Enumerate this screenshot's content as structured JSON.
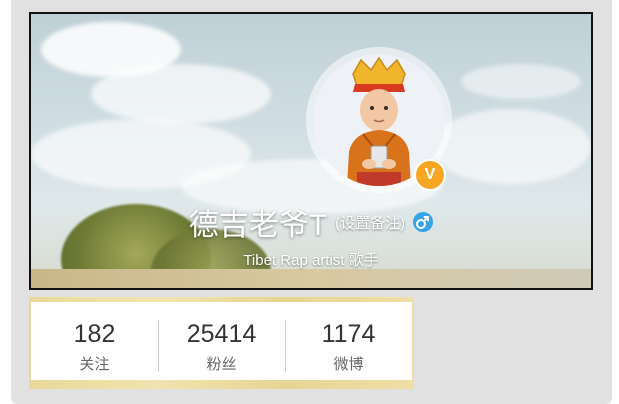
{
  "profile": {
    "nickname": "德吉老爷T",
    "remark_link": "(设置备注)",
    "bio": "Tibet Rap artist 歌手",
    "verified_mark": "V",
    "gender": "male",
    "gender_symbol": "♂"
  },
  "stats": [
    {
      "count": "182",
      "label": "关注"
    },
    {
      "count": "25414",
      "label": "粉丝"
    },
    {
      "count": "1174",
      "label": "微博"
    }
  ],
  "colors": {
    "verified_badge": "#f5a623",
    "gender_badge": "#38a4e8",
    "stats_border": "#e8d99a",
    "page_background": "#e1e1e1"
  }
}
